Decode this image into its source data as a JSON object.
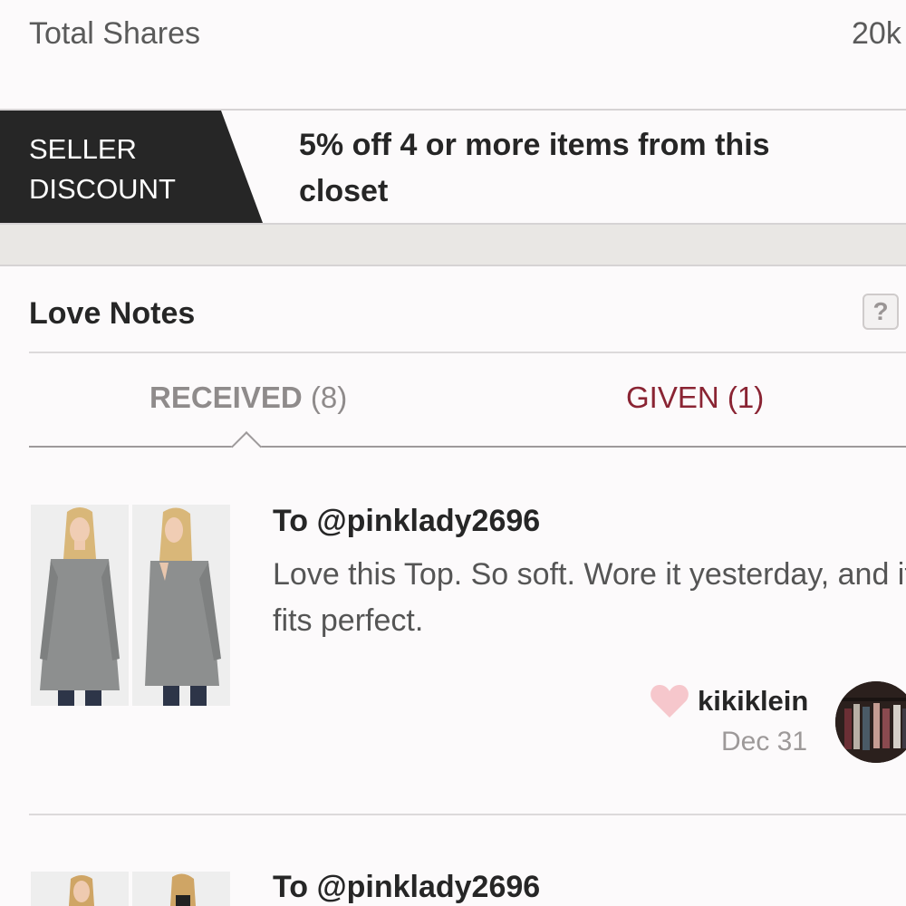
{
  "stats": {
    "total_shares_label": "Total Shares",
    "total_shares_value": "20k"
  },
  "seller_discount": {
    "tag": "SELLER DISCOUNT",
    "text": "5% off 4 or more items from this closet"
  },
  "love_notes": {
    "title": "Love Notes",
    "help_label": "?",
    "tabs": [
      {
        "name": "RECEIVED",
        "count": "(8)",
        "active": true
      },
      {
        "name": "GIVEN",
        "count": "(1)",
        "active": false
      }
    ],
    "notes": [
      {
        "to": "To @pinklady2696",
        "text": "Love this Top. So soft. Wore it yesterday, and it fits perfect.",
        "author": "kikiklein",
        "date": "Dec 31"
      },
      {
        "to": "To @pinklady2696"
      }
    ]
  },
  "colors": {
    "accent": "#8a2433",
    "heart": "#f6c7cc",
    "tag_bg": "#262626"
  },
  "icons": {
    "heart": "heart-icon",
    "help": "question-icon"
  }
}
